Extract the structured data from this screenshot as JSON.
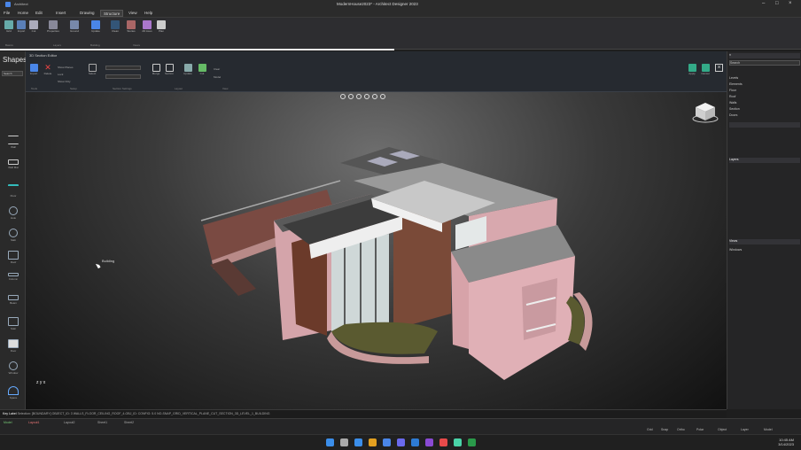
{
  "window": {
    "title": "ModernHouse2023* - Architect Designer 2023",
    "app_label": "Architect"
  },
  "menu": {
    "items": [
      "File",
      "Home",
      "Edit",
      "Insert",
      "Drawing",
      "Structure",
      "View",
      "Help"
    ],
    "active_index": 5
  },
  "ribbon": {
    "buttons": [
      "Grid",
      "Import",
      "Cut",
      "Properties",
      "Ground",
      "Update",
      "Clean",
      "Stories",
      "2D Axes",
      "Plan",
      "Room"
    ],
    "groups": [
      "Basics",
      "Layers",
      "Building",
      "Views"
    ]
  },
  "shapes_panel": {
    "title": "Shapes",
    "search": "Search",
    "tools": [
      "Wall",
      "Wall Mat",
      "Floor",
      "Hole",
      "Slab",
      "Roof",
      "Column",
      "Beam",
      "Stair",
      "Door",
      "Window",
      "Space"
    ]
  },
  "editor": {
    "title": "3D Section Editor",
    "buttons": [
      "Import",
      "Delete",
      "Select",
      "Merge",
      "Section",
      "Update",
      "Cut",
      "Clear",
      "Model",
      "Model",
      "Apply",
      "Cancel"
    ],
    "groups": [
      "Tools",
      "Setup",
      "Section Settings",
      "Layout",
      "View"
    ],
    "options": [
      "Show Planes",
      "Lock",
      "Show Only"
    ]
  },
  "viewport": {
    "cursor_tip": "Building",
    "axes": "z y x",
    "icon_names": [
      "orbit-icon",
      "pan-icon",
      "zoom-icon",
      "fit-icon",
      "walk-icon",
      "section-icon"
    ]
  },
  "right_panel": {
    "search": "Search",
    "rows": [
      "Levels",
      "Elements",
      "Floor",
      "Roof",
      "Walls",
      "Section",
      "Doors",
      "Windows",
      "Details"
    ],
    "section2_title": "Layers",
    "section3_title": "Views"
  },
  "command_line": {
    "label": "Key Label",
    "text": "Selection: [BOUNDARY] OBJECT_ID: 3 WALLS_FLOOR_CEILING_ROOF_4-OBJ_ID: CONFIG: 5.0 NO-SNAP_GRID_VERTICAL_PLANE_CUT_SECTION_3D_LEVEL_1_BUILDING"
  },
  "status_bar": {
    "tabs": [
      "Model",
      "Layout1",
      "Layout2",
      "Sheet1",
      "Sheet2"
    ],
    "right": [
      "Grid",
      "Snap",
      "Ortho",
      "Polar",
      "Object",
      "Layer",
      "Model"
    ]
  },
  "taskbar": {
    "time": "10:45 AM",
    "date": "3/14/2023"
  },
  "colors": {
    "accent": "#4a86e8",
    "wall_pink": "#d8a8ae",
    "roof_gray": "#8a8a8a",
    "brick": "#6b3a2a"
  }
}
